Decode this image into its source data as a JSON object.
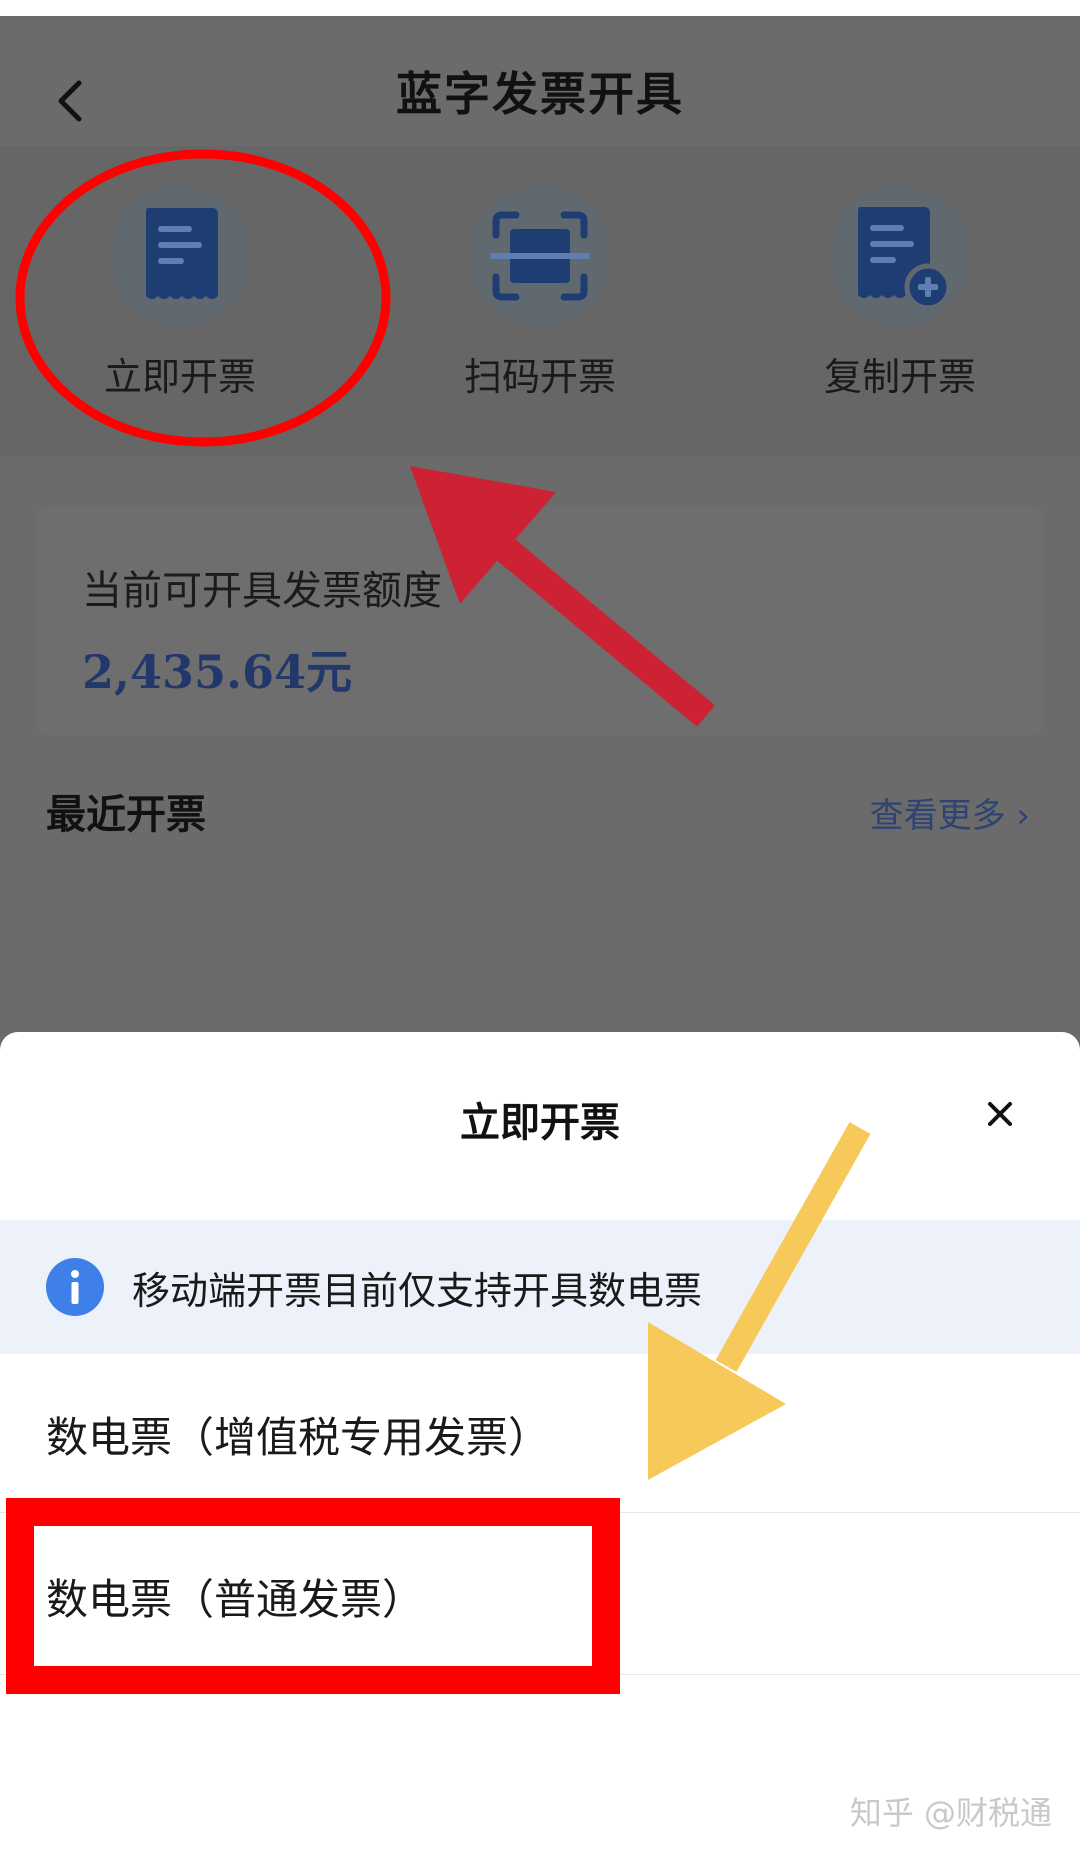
{
  "navbar": {
    "title": "蓝字发票开具"
  },
  "actions": [
    {
      "label": "立即开票",
      "icon": "receipt-icon"
    },
    {
      "label": "扫码开票",
      "icon": "scan-icon"
    },
    {
      "label": "复制开票",
      "icon": "receipt-add-icon"
    }
  ],
  "quota": {
    "label": "当前可开具发票额度",
    "amount": "2,435.64元"
  },
  "recent": {
    "title": "最近开票",
    "more": "查看更多 ›"
  },
  "sheet": {
    "title": "立即开票",
    "notice": "移动端开票目前仅支持开具数电票",
    "options": [
      "数电票（增值税专用发票）",
      "数电票（普通发票）"
    ]
  },
  "watermark": "知乎 @财税通",
  "colors": {
    "overlay": "#6b6b6b",
    "accent": "#3f80e8",
    "highlight": "#ff0000",
    "arrow_red": "#cc2233",
    "arrow_yellow": "#f7c85a"
  }
}
